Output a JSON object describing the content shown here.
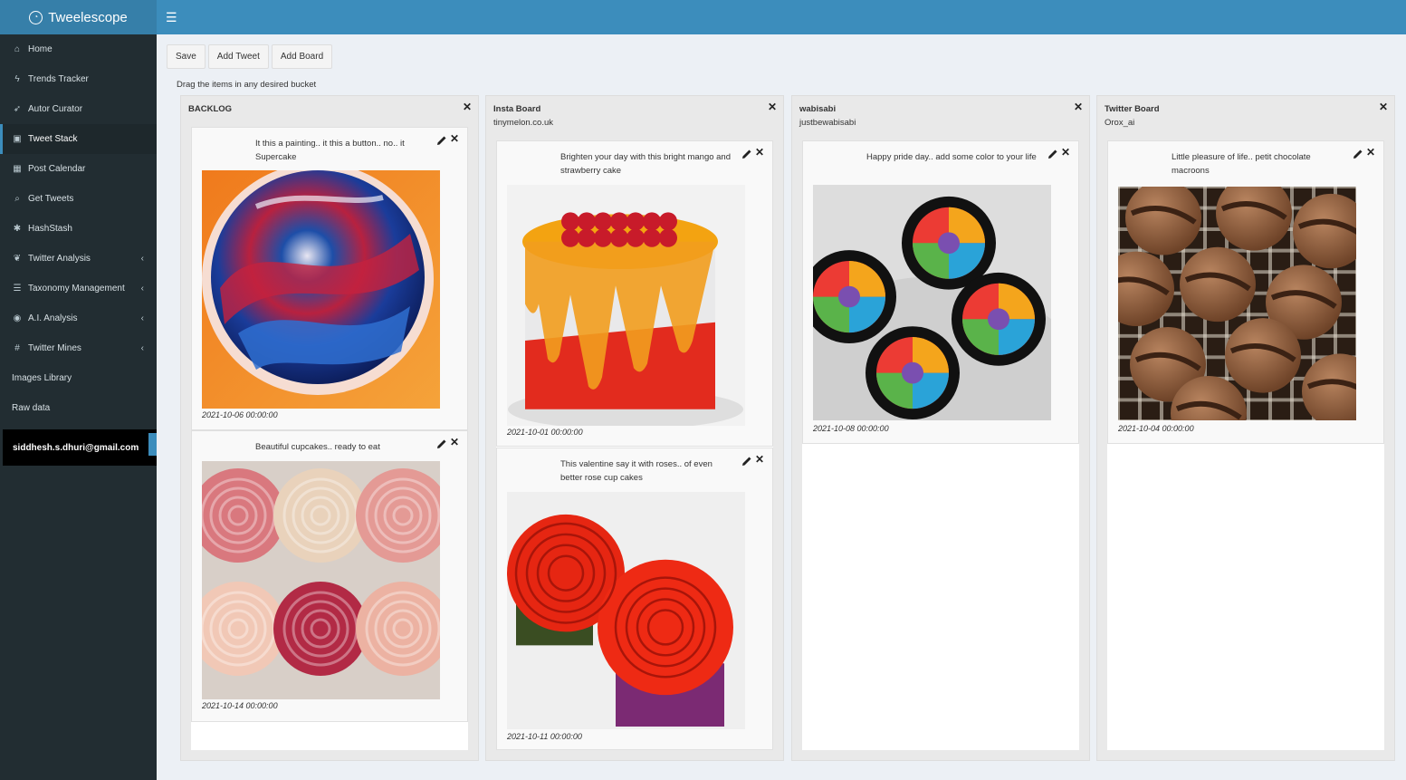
{
  "app": {
    "title": "Tweelescope"
  },
  "sidebar": {
    "items": [
      {
        "icon": "home-icon",
        "glyph": "⌂",
        "label": "Home"
      },
      {
        "icon": "bolt-icon",
        "glyph": "ϟ",
        "label": "Trends Tracker"
      },
      {
        "icon": "rocket-icon",
        "glyph": "➶",
        "label": "Autor Curator"
      },
      {
        "icon": "stack-icon",
        "glyph": "▣",
        "label": "Tweet Stack",
        "active": true
      },
      {
        "icon": "calendar-icon",
        "glyph": "▦",
        "label": "Post Calendar"
      },
      {
        "icon": "chat-icon",
        "glyph": "⌕",
        "label": "Get Tweets"
      },
      {
        "icon": "asterisk-icon",
        "glyph": "✱",
        "label": "HashStash"
      },
      {
        "icon": "twitter-icon",
        "glyph": "❦",
        "label": "Twitter Analysis",
        "expandable": true
      },
      {
        "icon": "list-icon",
        "glyph": "☰",
        "label": "Taxonomy Management",
        "expandable": true
      },
      {
        "icon": "brain-icon",
        "glyph": "◉",
        "label": "A.I. Analysis",
        "expandable": true
      },
      {
        "icon": "hash-icon",
        "glyph": "#",
        "label": "Twitter Mines",
        "expandable": true
      },
      {
        "icon": "",
        "glyph": "",
        "label": "Images Library"
      },
      {
        "icon": "",
        "glyph": "",
        "label": "Raw data"
      }
    ],
    "user_email": "siddhesh.s.dhuri@gmail.com"
  },
  "toolbar": {
    "save": "Save",
    "add_tweet": "Add Tweet",
    "add_board": "Add Board"
  },
  "hint": "Drag the items in any desired bucket",
  "boards": [
    {
      "title": "BACKLOG",
      "subtitle": "",
      "cards": [
        {
          "text": "It this a painting.. it this a button.. no.. it Supercake",
          "date": "2021-10-06 00:00:00",
          "image": "mirror-glaze-cake"
        },
        {
          "text": "Beautiful cupcakes.. ready to eat",
          "date": "2021-10-14 00:00:00",
          "image": "rose-cupcakes-box"
        }
      ]
    },
    {
      "title": "Insta Board",
      "subtitle": "tinymelon.co.uk",
      "cards": [
        {
          "text": "Brighten your day with this bright mango and strawberry cake",
          "date": "2021-10-01 00:00:00",
          "image": "mango-strawberry-cake"
        },
        {
          "text": "This valentine say it with roses.. of even better rose cup cakes",
          "date": "2021-10-11 00:00:00",
          "image": "red-rose-cupcakes"
        }
      ]
    },
    {
      "title": "wabisabi",
      "subtitle": "justbewabisabi",
      "cards": [
        {
          "text": "Happy pride day.. add some color to your life",
          "date": "2021-10-08 00:00:00",
          "image": "rainbow-cupcakes"
        }
      ]
    },
    {
      "title": "Twitter Board",
      "subtitle": "Orox_ai",
      "cards": [
        {
          "text": "Little pleasure of life.. petit chocolate macroons",
          "date": "2021-10-04 00:00:00",
          "image": "chocolate-macarons"
        }
      ]
    }
  ],
  "colors": {
    "header": "#3c8dbc",
    "logo_bg": "#367fa9",
    "sidebar": "#222d32",
    "sidebar_active": "#1e282c",
    "content_bg": "#ecf0f5"
  }
}
